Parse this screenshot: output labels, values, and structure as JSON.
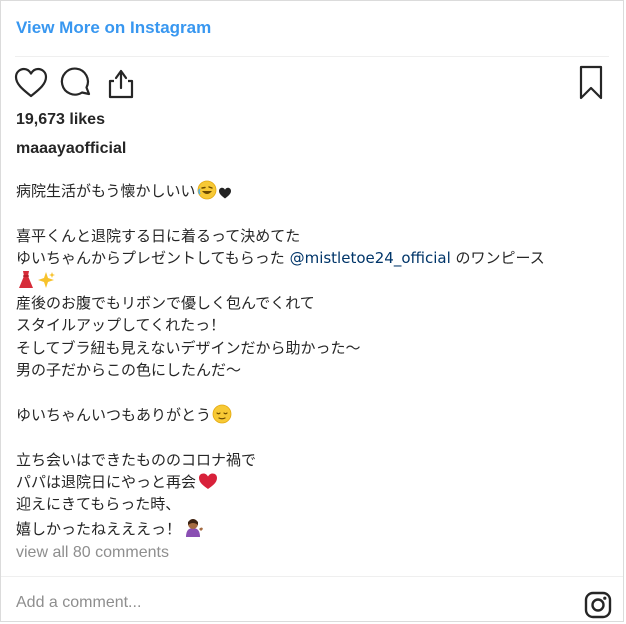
{
  "header": {
    "view_more_label": "View More on Instagram"
  },
  "actions": {
    "like_icon": "heart-icon",
    "comment_icon": "comment-bubble-icon",
    "share_icon": "share-upload-icon",
    "save_icon": "bookmark-icon"
  },
  "post": {
    "likes": "19,673 likes",
    "username": "maaayaofficial",
    "caption": {
      "line1": "病院生活がもう懐かしいい",
      "line1_emojis": [
        "rofl-emoji",
        "black-heart-emoji"
      ],
      "line2": "喜平くんと退院する日に着るって決めてた",
      "line3_before": "ゆいちゃんからプレゼントしてもらった ",
      "line3_mention": "@mistletoe24_official",
      "line3_after": " のワンピース",
      "line4_emojis": [
        "dress-emoji",
        "sparkles-emoji"
      ],
      "line5": "産後のお腹でもリボンで優しく包んでくれて",
      "line6": "スタイルアップしてくれたっ！",
      "line7": "そしてブラ紐も見えないデザインだから助かった〜",
      "line8": "男の子だからこの色にしたんだ〜",
      "line9": "ゆいちゃんいつもありがとう",
      "line9_emojis": [
        "relieved-face-emoji"
      ],
      "line10": "立ち会いはできたもののコロナ禍で",
      "line11": "パパは退院日にやっと再会",
      "line11_emojis": [
        "heart-exclamation-emoji"
      ],
      "line12": "迎えにきてもらった時、",
      "line13": "嬉しかったねえええっ！",
      "line13_emojis": [
        "person-tipping-hand-emoji"
      ]
    },
    "view_comments": "view all 80 comments"
  },
  "comment_box": {
    "placeholder": "Add a comment..."
  },
  "footer": {
    "logo_icon": "instagram-logo-icon"
  },
  "colors": {
    "link_blue": "#3897f0",
    "mention_blue": "#003569",
    "text": "#262626",
    "muted": "#8e8e8e",
    "border": "#dbdbdb"
  }
}
